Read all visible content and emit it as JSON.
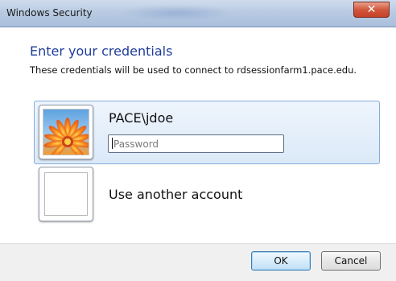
{
  "window": {
    "title": "Windows Security",
    "close_label": "✕"
  },
  "dialog": {
    "heading": "Enter your credentials",
    "description": "These credentials will be used to connect to rdsessionfarm1.pace.edu."
  },
  "accounts": {
    "selected": {
      "username": "PACE\\jdoe",
      "password_placeholder": "Password",
      "avatar_icon": "flower-avatar-icon"
    },
    "other": {
      "label": "Use another account",
      "avatar_icon": "blank-avatar-icon"
    }
  },
  "buttons": {
    "ok_label": "OK",
    "cancel_label": "Cancel"
  },
  "colors": {
    "heading": "#1e3d9a",
    "selection_bg": "#dbe9f8",
    "selection_border": "#84acdd",
    "close_button": "#c4402a"
  }
}
